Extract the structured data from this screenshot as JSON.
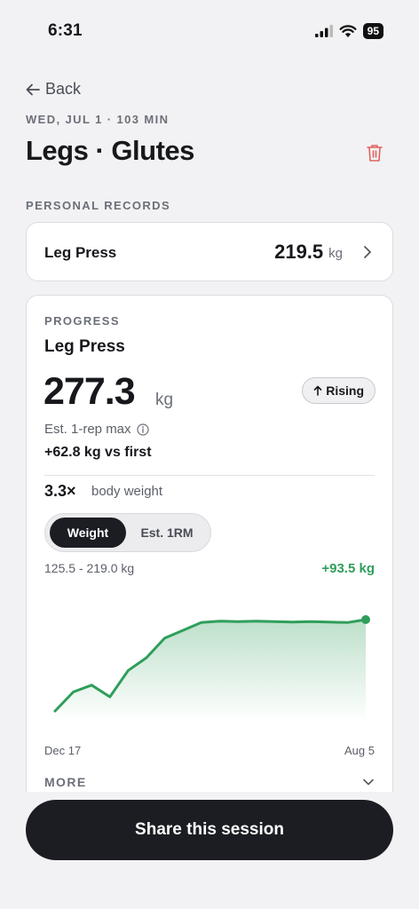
{
  "status_bar": {
    "time": "6:31",
    "battery": "95"
  },
  "nav": {
    "back_label": "Back"
  },
  "session": {
    "date_line": "WED, JUL 1 · 103 MIN",
    "title": "Legs · Glutes"
  },
  "personal_records": {
    "section_label": "PERSONAL RECORDS",
    "items": [
      {
        "name": "Leg Press",
        "value": "219.5",
        "unit": "kg"
      }
    ]
  },
  "progress": {
    "section_label": "PROGRESS",
    "exercise": "Leg Press",
    "value": "277.3",
    "unit": "kg",
    "trend_badge": "Rising",
    "subtitle": "Est. 1-rep max",
    "delta": "+62.8 kg vs first",
    "bodyweight_ratio": "3.3×",
    "bodyweight_label": "body weight",
    "tabs": [
      {
        "label": "Weight",
        "active": true
      },
      {
        "label": "Est. 1RM",
        "active": false
      }
    ],
    "range": "125.5 - 219.0 kg",
    "change": "+93.5 kg",
    "more_label": "MORE"
  },
  "chart_data": {
    "type": "area",
    "x_start_label": "Dec 17",
    "x_end_label": "Aug 5",
    "ylim": [
      125.5,
      219.0
    ],
    "series": [
      {
        "values": [
          125.5,
          145,
          152,
          140,
          167,
          180,
          200,
          208,
          216,
          217.5,
          217,
          217.5,
          217,
          216.5,
          217,
          216.5,
          216,
          219.0
        ]
      }
    ],
    "colors": {
      "line": "#2f9e5a"
    }
  },
  "footer": {
    "share_label": "Share this session"
  }
}
